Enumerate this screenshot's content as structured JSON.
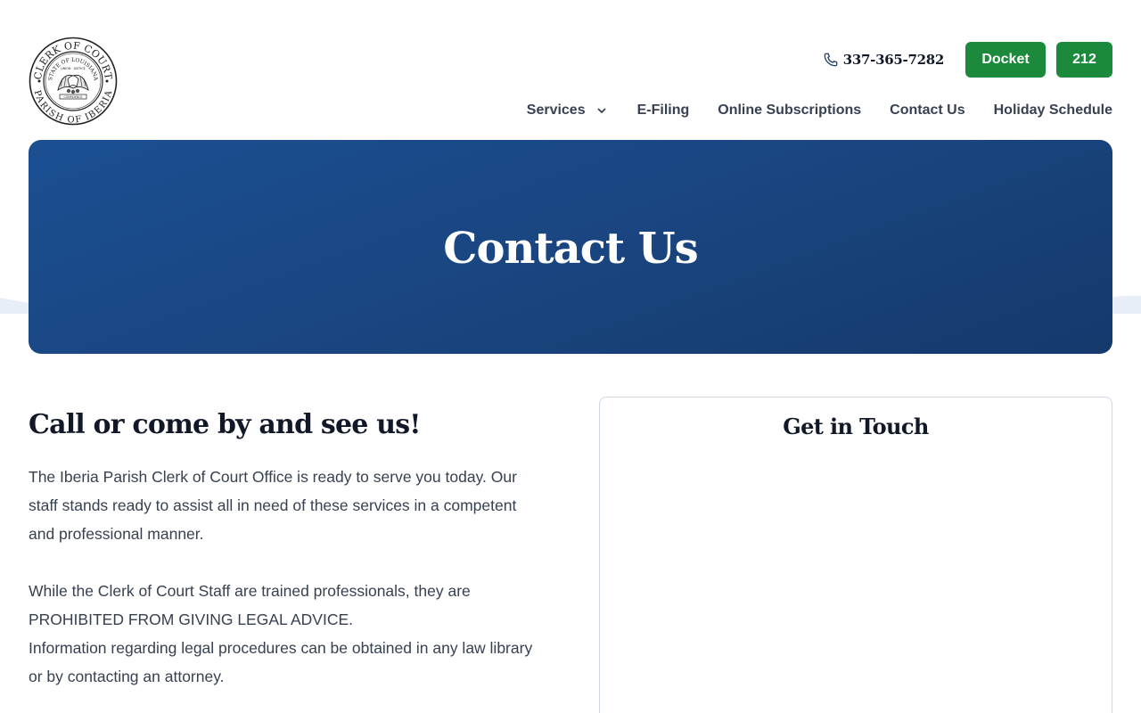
{
  "header": {
    "logo": {
      "icon": "court-seal-logo",
      "ring_top_text": "CLERK OF COURT",
      "ring_bottom_text": "PARISH OF IBERIA",
      "inner_top_text": "STATE OF LOUISIANA",
      "motto_text": "UNION · JUSTICE",
      "ribbon_text": "CONFIDENCE"
    },
    "phone": {
      "icon": "phone-icon",
      "number": "337-365-7282"
    },
    "buttons": {
      "docket": "Docket",
      "other": "212"
    },
    "nav": [
      {
        "label": "Services",
        "has_dropdown": true,
        "dropdown_icon": "chevron-down-icon"
      },
      {
        "label": "E-Filing"
      },
      {
        "label": "Online Subscriptions"
      },
      {
        "label": "Contact Us"
      },
      {
        "label": "Holiday Schedule"
      }
    ]
  },
  "hero": {
    "title": "Contact Us"
  },
  "main": {
    "heading": "Call or come by and see us!",
    "paragraph1": "The Iberia Parish Clerk of Court Office is ready to serve you today. Our staff stands ready to assist all in need of these services in a competent and professional manner.",
    "paragraph2_line1": "While the Clerk of Court Staff are trained professionals, they are PROHIBITED FROM GIVING LEGAL ADVICE.",
    "paragraph2_line2": "Information regarding legal procedures can be obtained in any law library or by contacting an attorney."
  },
  "contact_card": {
    "title": "Get in Touch"
  },
  "colors": {
    "brand_blue": "#1a4682",
    "brand_green": "#1c8a3c",
    "text_dark": "#111827",
    "text_body": "#374151"
  }
}
